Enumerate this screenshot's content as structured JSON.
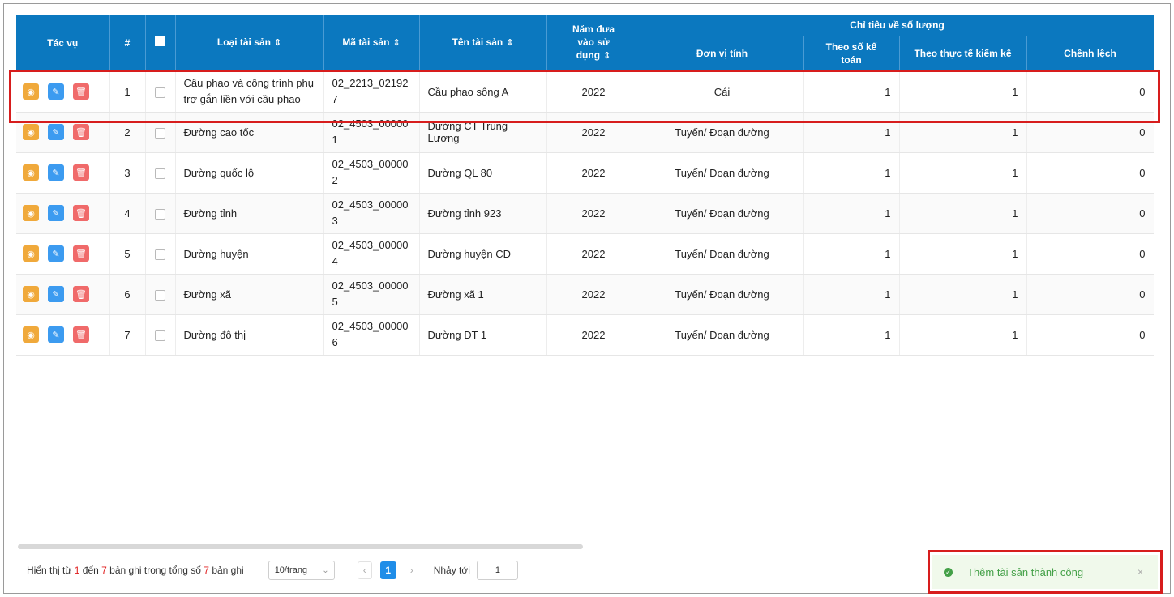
{
  "table": {
    "headers": {
      "actions": "Tác vụ",
      "index": "#",
      "asset_type": "Loại tài sản",
      "asset_code": "Mã tài sản",
      "asset_name": "Tên tài sản",
      "year": "Năm đưa vào sử dụng",
      "quantity_group": "Chỉ tiêu về số lượng",
      "unit": "Đơn vị tính",
      "by_books": "Theo số kế toán",
      "by_inventory": "Theo thực tế kiểm kê",
      "difference": "Chênh lệch"
    },
    "rows": [
      {
        "index": "1",
        "type": "Cầu phao và công trình phụ trợ gắn liền với cầu phao",
        "code": "02_2213_021927",
        "name": "Cầu phao sông A",
        "year": "2022",
        "unit": "Cái",
        "books": "1",
        "inventory": "1",
        "diff": "0"
      },
      {
        "index": "2",
        "type": "Đường cao tốc",
        "code": "02_4503_000001",
        "name": "Đường CT Trung Lương",
        "year": "2022",
        "unit": "Tuyến/ Đoạn đường",
        "books": "1",
        "inventory": "1",
        "diff": "0"
      },
      {
        "index": "3",
        "type": "Đường quốc lộ",
        "code": "02_4503_000002",
        "name": "Đường QL 80",
        "year": "2022",
        "unit": "Tuyến/ Đoạn đường",
        "books": "1",
        "inventory": "1",
        "diff": "0"
      },
      {
        "index": "4",
        "type": "Đường tỉnh",
        "code": "02_4503_000003",
        "name": "Đường tỉnh 923",
        "year": "2022",
        "unit": "Tuyến/ Đoạn đường",
        "books": "1",
        "inventory": "1",
        "diff": "0"
      },
      {
        "index": "5",
        "type": "Đường huyện",
        "code": "02_4503_000004",
        "name": "Đường huyện CĐ",
        "year": "2022",
        "unit": "Tuyến/ Đoạn đường",
        "books": "1",
        "inventory": "1",
        "diff": "0"
      },
      {
        "index": "6",
        "type": "Đường xã",
        "code": "02_4503_000005",
        "name": "Đường xã 1",
        "year": "2022",
        "unit": "Tuyến/ Đoạn đường",
        "books": "1",
        "inventory": "1",
        "diff": "0"
      },
      {
        "index": "7",
        "type": "Đường đô thị",
        "code": "02_4503_000006",
        "name": "Đường ĐT 1",
        "year": "2022",
        "unit": "Tuyến/ Đoạn đường",
        "books": "1",
        "inventory": "1",
        "diff": "0"
      }
    ]
  },
  "footer": {
    "summary_prefix": "Hiển thị từ",
    "from": "1",
    "to_word": "đến",
    "to": "7",
    "summary_mid": "bản ghi trong tổng số",
    "total": "7",
    "summary_suffix": "bản ghi",
    "page_size": "10/trang",
    "current_page": "1",
    "jump_label": "Nhảy tới",
    "jump_value": "1"
  },
  "toast": {
    "message": "Thêm tài sản thành công",
    "close": "×"
  },
  "colors": {
    "header": "#0b78bf",
    "view_button": "#f0a93b",
    "edit_button": "#3c9bf0",
    "delete_button": "#f06a6a",
    "highlight": "#d71d1d",
    "success": "#43a047"
  }
}
